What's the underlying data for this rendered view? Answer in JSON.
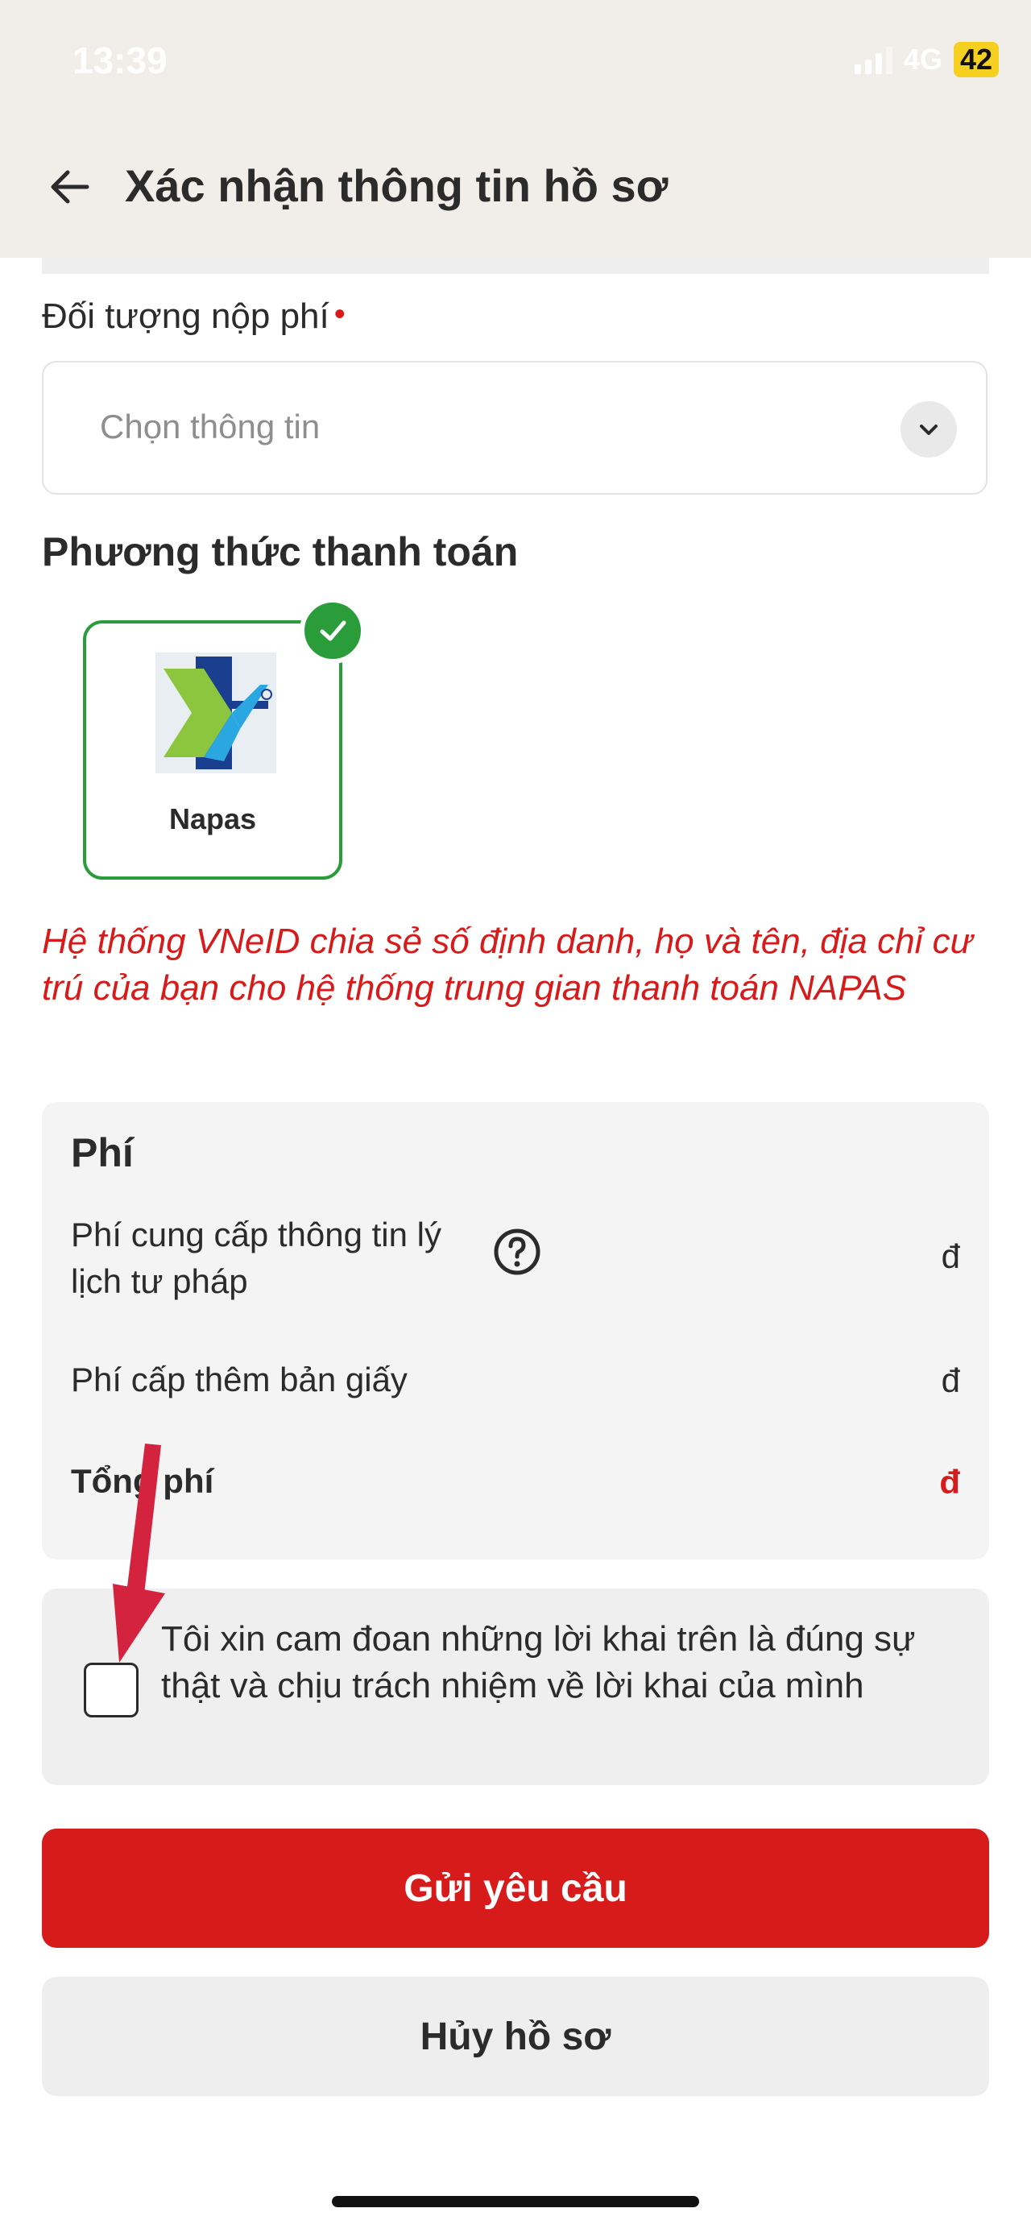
{
  "status_bar": {
    "time": "13:39",
    "network": "4G",
    "battery": "42"
  },
  "header": {
    "title": "Xác nhận thông tin hồ sơ"
  },
  "payer": {
    "label": "Đối tượng nộp phí",
    "required_mark": "•",
    "placeholder": "Chọn thông tin"
  },
  "payment": {
    "title": "Phương thức thanh toán",
    "methods": [
      {
        "label": "Napas",
        "selected": true
      }
    ]
  },
  "notice": "Hệ thống VNeID chia sẻ số định danh, họ và tên, địa chỉ cư trú của bạn cho hệ thống trung gian thanh toán NAPAS",
  "fees": {
    "title": "Phí",
    "rows": [
      {
        "label": "Phí cung cấp thông tin lý lịch tư pháp",
        "value": "đ"
      },
      {
        "label": "Phí cấp thêm bản giấy",
        "value": "đ"
      }
    ],
    "total_label": "Tổng phí",
    "total_value": "đ"
  },
  "agreement": {
    "text": "Tôi xin cam đoan những lời khai trên là đúng sự thật và chịu trách nhiệm về lời khai của mình",
    "checked": false
  },
  "actions": {
    "submit": "Gửi yêu cầu",
    "cancel": "Hủy hồ sơ"
  },
  "colors": {
    "accent_red": "#d71a1a",
    "success_green": "#2a9d3a",
    "header_bg": "#f1ede9"
  },
  "icons": [
    "back-arrow-icon",
    "chevron-down-icon",
    "check-icon",
    "napas-logo",
    "help-circle-icon",
    "annotation-arrow"
  ]
}
